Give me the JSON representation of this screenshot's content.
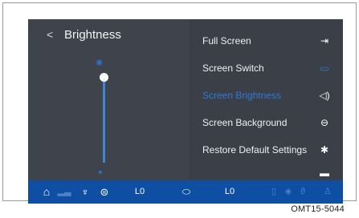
{
  "header": {
    "back_glyph": "<",
    "title": "Brightness"
  },
  "brightness": {
    "level": 1.0,
    "min_icon": "sun-small-icon",
    "max_icon": "sun-large-icon"
  },
  "menu": [
    {
      "label": "Full Screen",
      "icon": "fullscreen-icon",
      "active": false
    },
    {
      "label": "Screen Switch",
      "icon": "screen-switch-icon",
      "active": false
    },
    {
      "label": "Screen Brightness",
      "icon": "brightness-icon",
      "active": true
    },
    {
      "label": "Screen Background",
      "icon": "background-icon",
      "active": false
    },
    {
      "label": "Restore Default Settings",
      "icon": "settings-gear-icon",
      "active": false
    },
    {
      "label": "",
      "icon": "book-icon",
      "active": false
    }
  ],
  "bottom_bar": {
    "left_temp": "L0",
    "right_temp": "L0",
    "icons": [
      "home-icon",
      "signal-icon",
      "seat-heat-icon",
      "car-recirc-icon",
      "ac-fan-icon",
      "rear-defrost-icon",
      "front-defrost-icon",
      "seat-icon"
    ]
  },
  "figure_code": "OMT15-5044",
  "colors": {
    "background": "#3b4049",
    "accent": "#2f7bd6",
    "bar": "#0f4fa3"
  }
}
